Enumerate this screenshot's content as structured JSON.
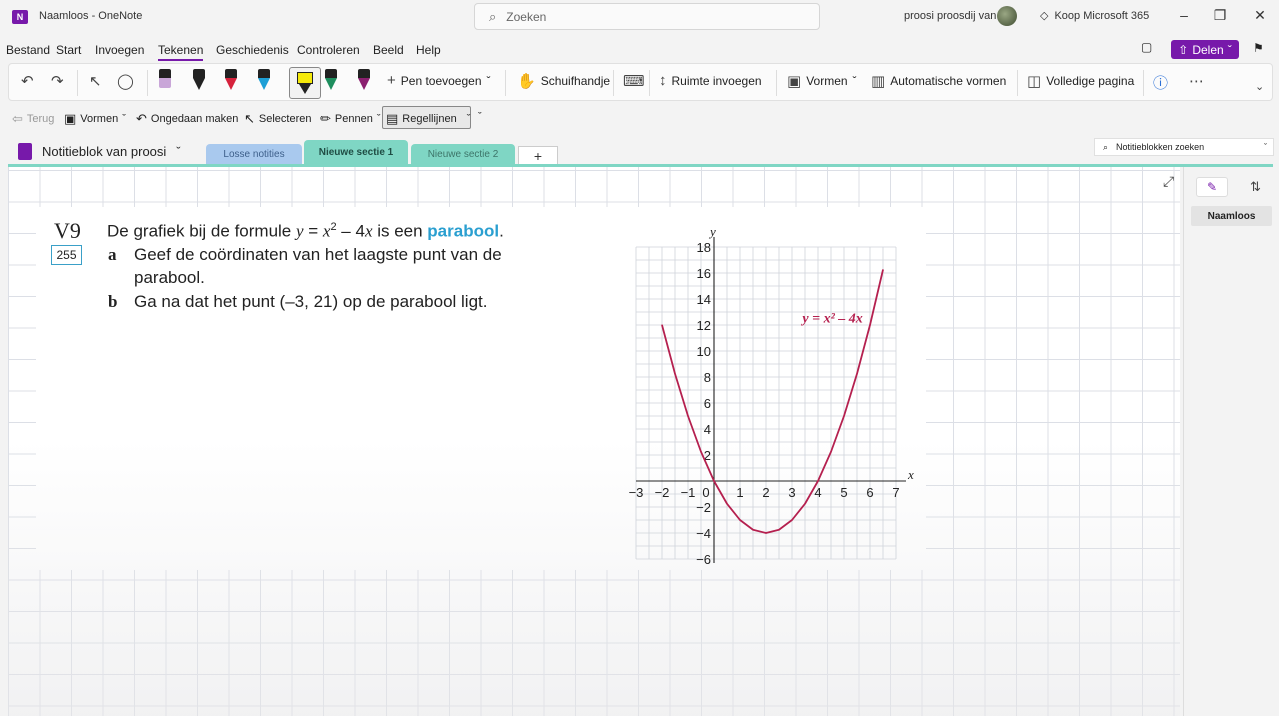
{
  "window": {
    "title": "Naamloos  -  OneNote",
    "search_placeholder": "Zoeken",
    "user_name": "proosi proosdij van",
    "buy_label": "Koop Microsoft 365"
  },
  "menu": {
    "items": [
      "Bestand",
      "Start",
      "Invoegen",
      "Tekenen",
      "Geschiedenis",
      "Controleren",
      "Beeld",
      "Help"
    ],
    "share_label": "Delen"
  },
  "ribbon": {
    "add_pen": "Pen toevoegen",
    "pan": "Schuifhandje",
    "insert_space": "Ruimte invoegen",
    "shapes": "Vormen",
    "auto_shapes": "Automatische vormen",
    "full_page": "Volledige pagina",
    "pen_colors": [
      "#c9a6d8",
      "#222222",
      "#d6223c",
      "#1d9fd6",
      "#f5e90a",
      "#1e8e5e",
      "#8b1f6f"
    ]
  },
  "subtoolbar": {
    "back": "Terug",
    "shapes": "Vormen",
    "undo": "Ongedaan maken",
    "select": "Selecteren",
    "pens": "Pennen",
    "rule_lines": "Regellijnen"
  },
  "notebook": {
    "name": "Notitieblok van proosi",
    "sections": [
      {
        "label": "Losse notities",
        "color": "#a9c9ee"
      },
      {
        "label": "Nieuwe sectie 1",
        "color": "#7fd6c4"
      },
      {
        "label": "Nieuwe sectie 2",
        "color": "#7fd6c4"
      }
    ],
    "search_placeholder": "Notitieblokken zoeken"
  },
  "exercise": {
    "number": "V9",
    "page_ref": "255",
    "intro_pre": "De grafiek bij de formule ",
    "formula_y": "y",
    "formula_eq": " = ",
    "formula_x": "x",
    "formula_sup": "2",
    "formula_rest": " – 4",
    "formula_x2": "x",
    "intro_post": " is een ",
    "keyword": "parabool",
    "period": ".",
    "part_a_label": "a",
    "part_a_line1": "Geef de coördinaten van het laagste punt van de",
    "part_a_line2": "parabool.",
    "part_b_label": "b",
    "part_b_text": "Ga na dat het punt (–3, 21) op de parabool ligt."
  },
  "chart_data": {
    "type": "line",
    "title": "",
    "xlabel": "x",
    "ylabel": "y",
    "xlim": [
      -3,
      7
    ],
    "ylim": [
      -6,
      18
    ],
    "x_ticks": [
      -3,
      -2,
      -1,
      0,
      1,
      2,
      3,
      4,
      5,
      6,
      7
    ],
    "y_ticks": [
      -6,
      -4,
      -2,
      0,
      2,
      4,
      6,
      8,
      10,
      12,
      14,
      16,
      18
    ],
    "curve_label": "y = x² – 4x",
    "series": [
      {
        "color": "#b5204f",
        "x": [
          -2,
          -1.5,
          -1,
          -0.5,
          0,
          0.5,
          1,
          1.5,
          2,
          2.5,
          3,
          3.5,
          4,
          4.5,
          5,
          5.5,
          6,
          6.5
        ],
        "y": [
          12,
          8.25,
          5,
          2.25,
          0,
          -1.75,
          -3,
          -3.75,
          -4,
          -3.75,
          -3,
          -1.75,
          0,
          2.25,
          5,
          8.25,
          12,
          16.25
        ]
      }
    ],
    "grid": true
  },
  "pages_pane": {
    "page_title": "Naamloos"
  }
}
